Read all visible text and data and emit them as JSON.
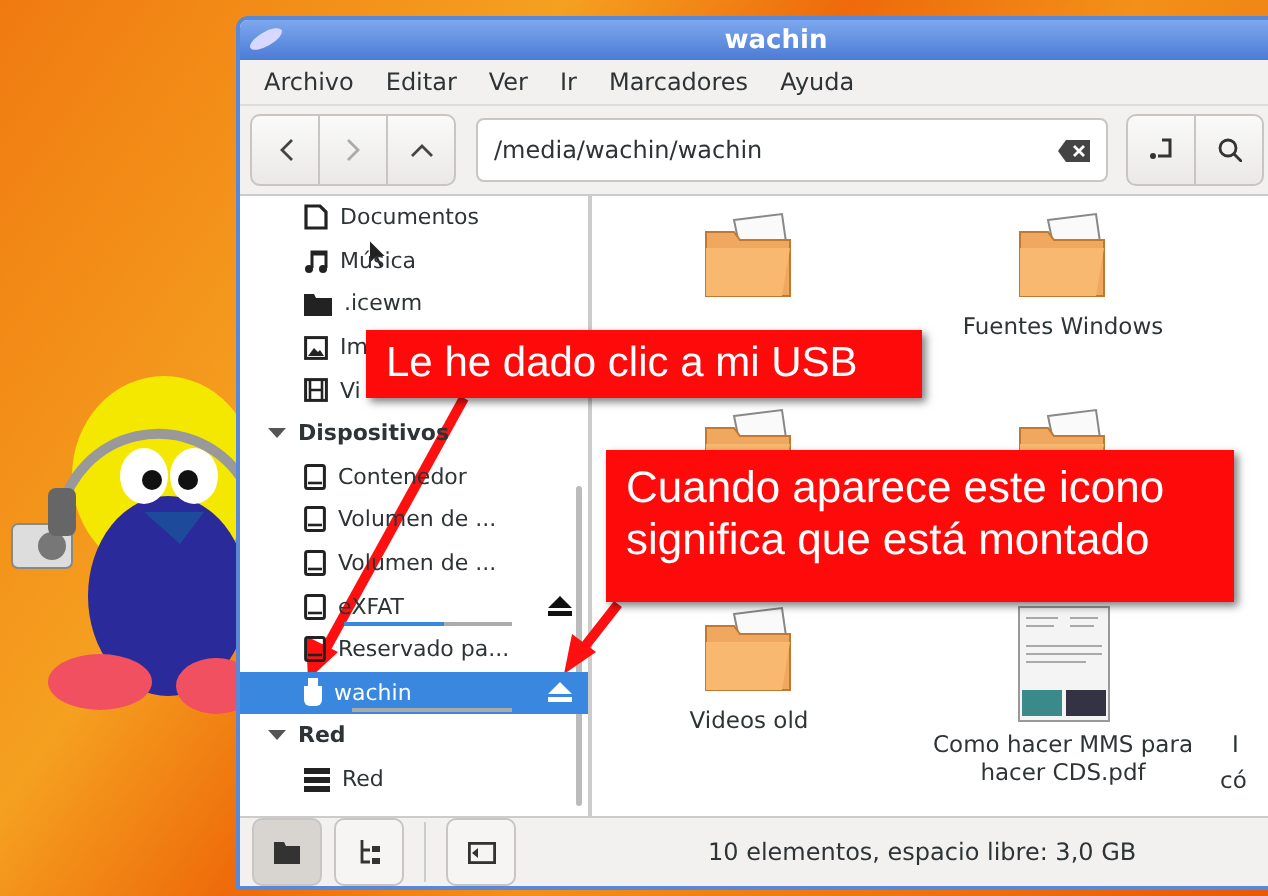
{
  "window": {
    "title": "wachin"
  },
  "menu": [
    "Archivo",
    "Editar",
    "Ver",
    "Ir",
    "Marcadores",
    "Ayuda"
  ],
  "location": {
    "value": "/media/wachin/wachin"
  },
  "sidebar": {
    "items": [
      {
        "label": "Documentos",
        "kind": "document",
        "selected": false
      },
      {
        "label": "Música",
        "kind": "music",
        "selected": false
      },
      {
        "label": ".icewm",
        "kind": "folder",
        "selected": false
      },
      {
        "label": "Im",
        "kind": "image",
        "selected": false
      },
      {
        "label": "Vi",
        "kind": "video",
        "selected": false
      }
    ],
    "sections": [
      {
        "title": "Dispositivos",
        "expanded": true,
        "items": [
          {
            "label": "Contenedor",
            "kind": "drive",
            "selected": false,
            "ejectable": false
          },
          {
            "label": "Volumen de ...",
            "kind": "drive",
            "selected": false,
            "ejectable": false
          },
          {
            "label": "Volumen de ...",
            "kind": "drive",
            "selected": false,
            "ejectable": false
          },
          {
            "label": "eXFAT",
            "kind": "drive",
            "selected": false,
            "ejectable": true,
            "level": 0.6
          },
          {
            "label": "Reservado pa...",
            "kind": "drive",
            "selected": false,
            "ejectable": false
          },
          {
            "label": "wachin",
            "kind": "usb",
            "selected": true,
            "ejectable": true,
            "level": 0.05
          }
        ]
      },
      {
        "title": "Red",
        "expanded": true,
        "items": [
          {
            "label": "Red",
            "kind": "network",
            "selected": false,
            "ejectable": false
          }
        ]
      }
    ]
  },
  "files": [
    {
      "kind": "folder"
    },
    {
      "kind": "folder",
      "label": "Fuentes Windows"
    },
    {
      "kind": "folder"
    },
    {
      "kind": "folder"
    },
    {
      "kind": "folder",
      "label": "Videos old"
    },
    {
      "kind": "pdf",
      "label": "Como hacer MMS para hacer CDS.pdf"
    }
  ],
  "edge_file": {
    "label": "I",
    "label_2": "có"
  },
  "status_bar": {
    "views": [
      {
        "kind": "icons",
        "selected": true
      },
      {
        "kind": "tree",
        "selected": false
      }
    ],
    "text": "10 elementos, espacio libre: 3,0 GB"
  },
  "callouts": [
    "Le he dado clic a mi USB",
    "Cuando aparece este icono significa que está montado"
  ]
}
